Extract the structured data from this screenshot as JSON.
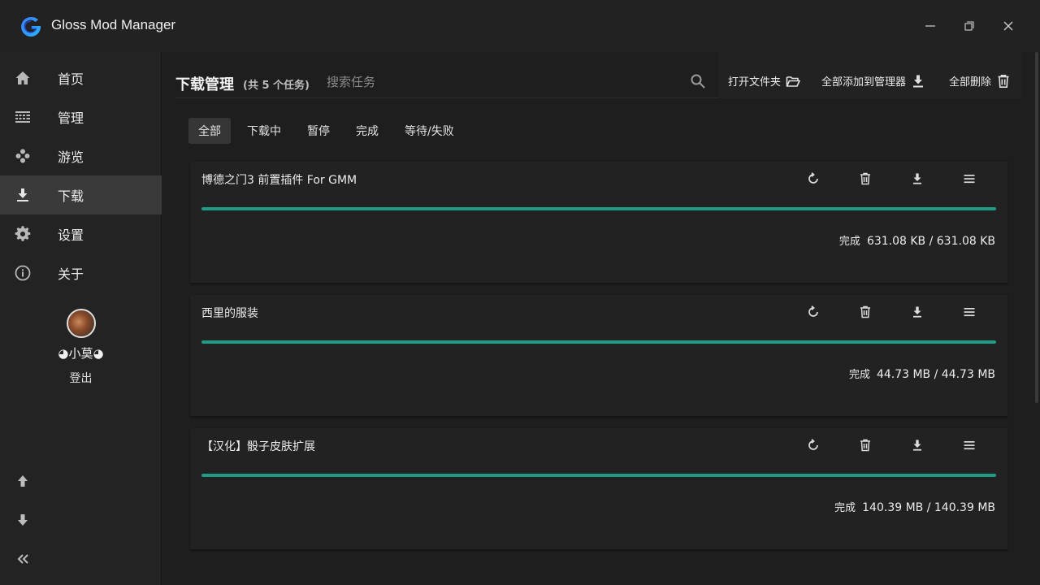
{
  "app": {
    "title": "Gloss Mod Manager",
    "accent": "#1f9c84",
    "logo_icon": "gloss-g-logo-icon"
  },
  "window_controls": {
    "minimize_icon": "minimize-icon",
    "maximize_icon": "maximize-icon",
    "close_icon": "close-icon"
  },
  "sidebar": {
    "items": [
      {
        "label": "首页",
        "icon": "home-icon",
        "active": false
      },
      {
        "label": "管理",
        "icon": "grid-list-icon",
        "active": false
      },
      {
        "label": "游览",
        "icon": "gamepad-icon",
        "active": false
      },
      {
        "label": "下载",
        "icon": "download-icon",
        "active": true
      },
      {
        "label": "设置",
        "icon": "gear-icon",
        "active": false
      },
      {
        "label": "关于",
        "icon": "info-icon",
        "active": false
      }
    ],
    "user": {
      "name": "◕小莫◕",
      "logout_label": "登出"
    },
    "bottom": [
      "arrow-up-icon",
      "arrow-down-icon",
      "collapse-icon"
    ]
  },
  "header": {
    "title": "下载管理",
    "task_count": "(共 5 个任务)",
    "search_placeholder": "搜索任务",
    "actions": {
      "open_folder": "打开文件夹",
      "add_all": "全部添加到管理器",
      "delete_all": "全部删除"
    }
  },
  "tabs": [
    {
      "label": "全部",
      "active": true
    },
    {
      "label": "下载中",
      "active": false
    },
    {
      "label": "暂停",
      "active": false
    },
    {
      "label": "完成",
      "active": false
    },
    {
      "label": "等待/失败",
      "active": false
    }
  ],
  "tasks": [
    {
      "name": "博德之门3 前置插件 For GMM",
      "status": "完成",
      "size": "631.08 KB / 631.08 KB",
      "progress": 1.0
    },
    {
      "name": "西里的服装",
      "status": "完成",
      "size": "44.73 MB / 44.73 MB",
      "progress": 1.0
    },
    {
      "name": "【汉化】骰子皮肤扩展",
      "status": "完成",
      "size": "140.39 MB / 140.39 MB",
      "progress": 1.0
    }
  ]
}
